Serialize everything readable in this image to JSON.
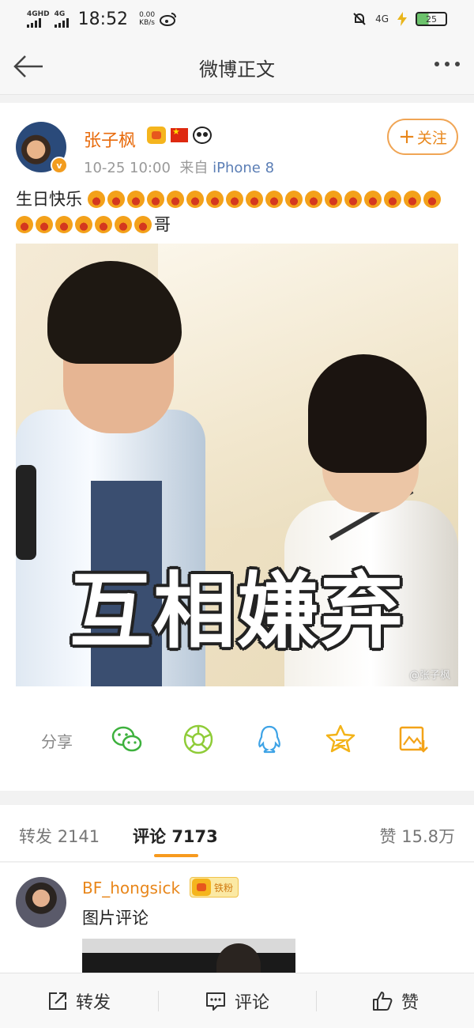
{
  "status_bar": {
    "sim1_label": "4GHD",
    "sim2_label": "4G",
    "time": "18:52",
    "speed_value": "0.00",
    "speed_unit": "KB/s",
    "network_right": "4G",
    "battery": "25",
    "icons": [
      "weibo-icon",
      "mute-bell-icon",
      "charging-icon",
      "battery-icon"
    ]
  },
  "nav": {
    "title": "微博正文",
    "back_icon": "arrow-left-icon",
    "more_icon": "more-dots-icon"
  },
  "post": {
    "author": "张子枫",
    "author_badges": [
      "crown-icon",
      "china-flag-icon",
      "panda-icon"
    ],
    "verified_label": "v",
    "time": "10-25 10:00",
    "source_prefix": "来自",
    "source": "iPhone 8",
    "follow_label": "关注",
    "follow_plus": "+",
    "text_start": "生日快乐",
    "emoji_count": 25,
    "text_end": "哥",
    "image_caption": "互相嫌弃",
    "image_watermark": "@张子枫"
  },
  "share": {
    "label": "分享",
    "targets": [
      "wechat-icon",
      "moments-icon",
      "qq-icon",
      "qzone-star-icon",
      "save-image-icon"
    ]
  },
  "tabs": [
    {
      "label": "转发",
      "count": "2141"
    },
    {
      "label": "评论",
      "count": "7173"
    },
    {
      "label": "赞",
      "count": "15.8万"
    }
  ],
  "comment": {
    "user": "BF_hongsick",
    "badge": "铁粉",
    "text": "图片评论"
  },
  "bottom_bar": {
    "repost": "转发",
    "comment": "评论",
    "like": "赞"
  },
  "colors": {
    "accent_orange": "#e8861a",
    "tab_underline": "#f79a1e",
    "link_blue": "#5b7eb5"
  }
}
